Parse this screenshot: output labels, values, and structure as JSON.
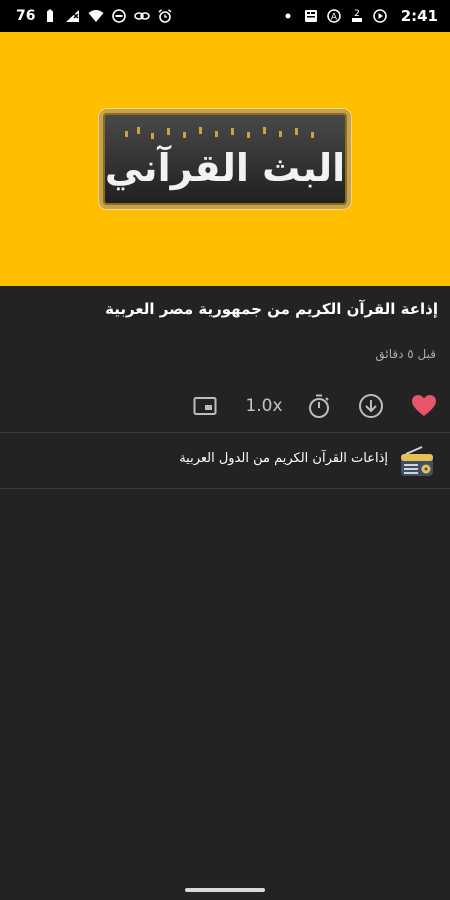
{
  "status_bar": {
    "battery": "76",
    "time": "2:41",
    "icons": [
      "battery-icon",
      "signal-icon",
      "wifi-icon",
      "dnd-icon",
      "link-icon",
      "alarm-icon",
      "notification-dot-icon",
      "card-icon",
      "at-icon",
      "data-2-icon",
      "play-icon"
    ]
  },
  "hero": {
    "logo_text": "البث القرآني",
    "bg_color": "#ffbf00"
  },
  "episode": {
    "title": "إذاعة القرآن الكريم من جمهورية مصر العربية",
    "time_ago": "قبل ٥ دقائق"
  },
  "actions": {
    "speed": "1.0x",
    "icons": [
      "pip-icon",
      "timer-icon",
      "download-icon",
      "heart-icon"
    ],
    "heart_color": "#e8546a"
  },
  "related": {
    "label": "إذاعات القرآن الكريم من الدول العربية"
  }
}
